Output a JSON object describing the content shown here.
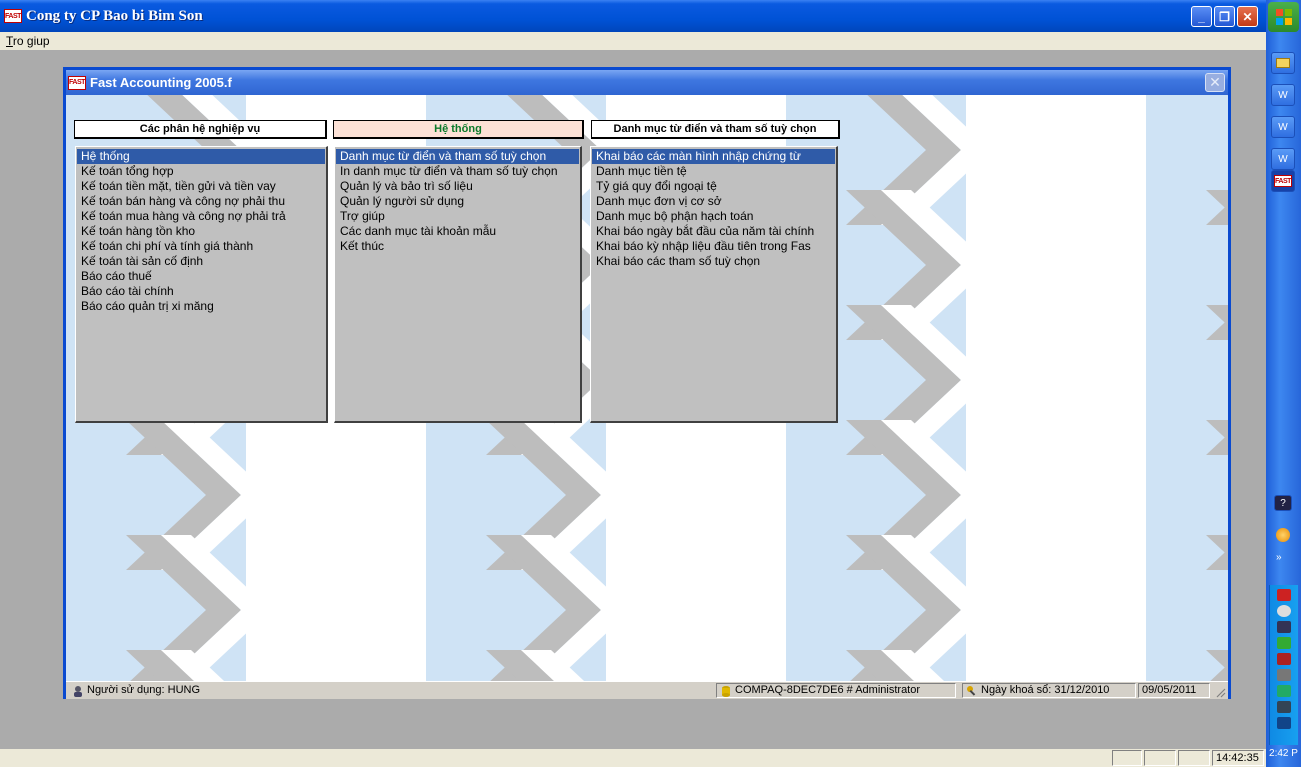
{
  "outer_window": {
    "title": "Cong ty CP Bao bi Bim Son",
    "logo_text": "FAST",
    "menu": [
      {
        "label": "Tro giup"
      }
    ]
  },
  "child_window": {
    "title": "Fast Accounting 2005.f",
    "logo_text": "FAST"
  },
  "panels": [
    {
      "header": "Các phân hệ nghiệp vụ",
      "items": [
        "Hệ thống",
        "Kế toán tổng hợp",
        "Kế toán tiền mặt, tiền gửi và tiền vay",
        "Kế toán bán hàng và công nợ phải thu",
        "Kế toán mua hàng và công nợ phải trả",
        "Kế toán hàng tồn kho",
        "Kế toán chi phí và tính giá thành",
        "Kế toán tài sản cố định",
        "Báo cáo thuế",
        "Báo cáo tài chính",
        "Báo cáo quản trị xi măng"
      ],
      "selected": 0
    },
    {
      "header": "Hệ thống",
      "items": [
        "Danh mục từ điển và tham số tuỳ chọn",
        "In danh mục từ điển và tham số tuỳ chọn",
        "Quản lý và bảo trì số liệu",
        "Quản lý người sử dụng",
        "Trợ giúp",
        "Các danh mục tài khoản mẫu",
        "Kết thúc"
      ],
      "selected": 0
    },
    {
      "header": "Danh mục từ điển và tham số tuỳ chọn",
      "items": [
        "Khai báo các màn hình nhập chứng từ",
        "Danh mục tiền tệ",
        "Tỷ giá quy đổi ngoại tệ",
        "Danh mục đơn vị cơ sở",
        "Danh mục bộ phận hạch toán",
        "Khai báo ngày bắt đầu của năm tài chính",
        "Khai báo kỳ nhập liệu đầu tiên trong Fas",
        "Khai báo các tham số tuỳ chọn"
      ],
      "selected": 0
    }
  ],
  "status_bar": {
    "user": "Người sử dụng: HUNG",
    "computer": "COMPAQ-8DEC7DE6 # Administrator",
    "lock_date": "Ngày khoá sổ: 31/12/2010",
    "date": "09/05/2011"
  },
  "app_status": {
    "time": "14:42:35"
  },
  "taskbar": {
    "clock": "2:42 P"
  }
}
